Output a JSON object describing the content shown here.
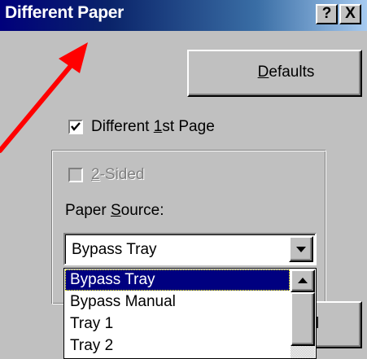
{
  "window": {
    "title": "Different Paper",
    "help_button": "?",
    "close_button": "X"
  },
  "defaults_button": {
    "label": "Defaults"
  },
  "different_first_page": {
    "label": "Different 1st Page",
    "checked": true
  },
  "two_sided": {
    "label": "2-Sided",
    "checked": false,
    "disabled": true
  },
  "paper_source": {
    "label": "Paper Source:",
    "selected_value": "Bypass Tray",
    "options": [
      "Bypass Tray",
      "Bypass Manual",
      "Tray 1",
      "Tray 2"
    ],
    "highlighted_index": 0
  },
  "partial_button": {
    "label": "l"
  },
  "annotation": {
    "arrow_color": "#ff0000"
  },
  "colors": {
    "titlebar_start": "#00007b",
    "titlebar_end": "#a6caf0",
    "dialog_bg": "#c0c0c0",
    "selection_bg": "#000080"
  }
}
